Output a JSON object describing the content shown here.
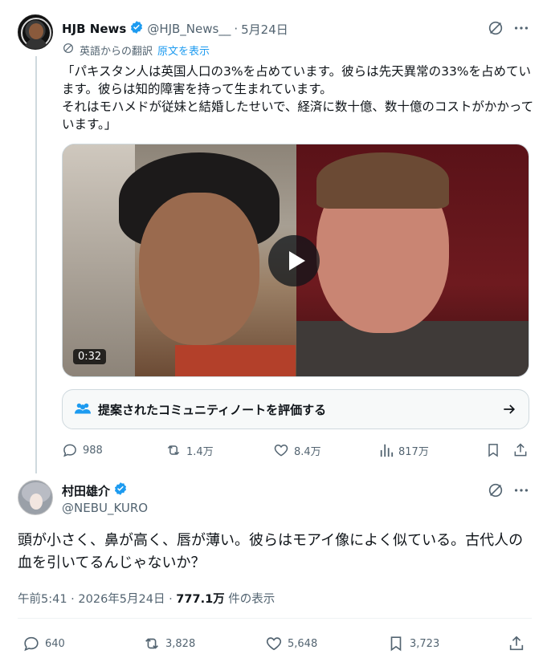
{
  "tweet": {
    "author_name": "HJB News",
    "author_handle": "@HJB_News__",
    "separator": "·",
    "date": "5月24日",
    "translation_label": "英語からの翻訳",
    "show_original": "原文を表示",
    "text": "「パキスタン人は英国人口の3%を占めています。彼らは先天異常の33%を占めています。彼らは知的障害を持って生まれています。\nそれはモハメドが従妹と結婚したせいで、経済に数十億、数十億のコストがかかっています。」",
    "video_duration": "0:32",
    "community_note": "提案されたコミュニティノートを評価する",
    "stats": {
      "replies": "988",
      "retweets": "1.4万",
      "likes": "8.4万",
      "views": "817万"
    }
  },
  "reply": {
    "author_name": "村田雄介",
    "author_handle": "@NEBU_KURO",
    "text": "頭が小さく、鼻が高く、唇が薄い。彼らはモアイ像によく似ている。古代人の血を引いてるんじゃないか？",
    "time": "午前5:41 · 2026年5月24日 · ",
    "views_count": "777.1万",
    "views_label": " 件の表示",
    "stats": {
      "replies": "640",
      "retweets": "3,828",
      "likes": "5,648",
      "bookmarks": "3,723"
    }
  },
  "colors": {
    "text": "#0f1419",
    "muted": "#536471",
    "accent": "#1d9bf0",
    "border": "#cfd9de"
  },
  "icons": [
    "verified-badge-icon",
    "grok-icon",
    "more-icon",
    "translate-icon",
    "play-icon",
    "community-notes-icon",
    "arrow-right-icon",
    "reply-icon",
    "retweet-icon",
    "like-icon",
    "views-icon",
    "bookmark-icon",
    "share-icon"
  ]
}
